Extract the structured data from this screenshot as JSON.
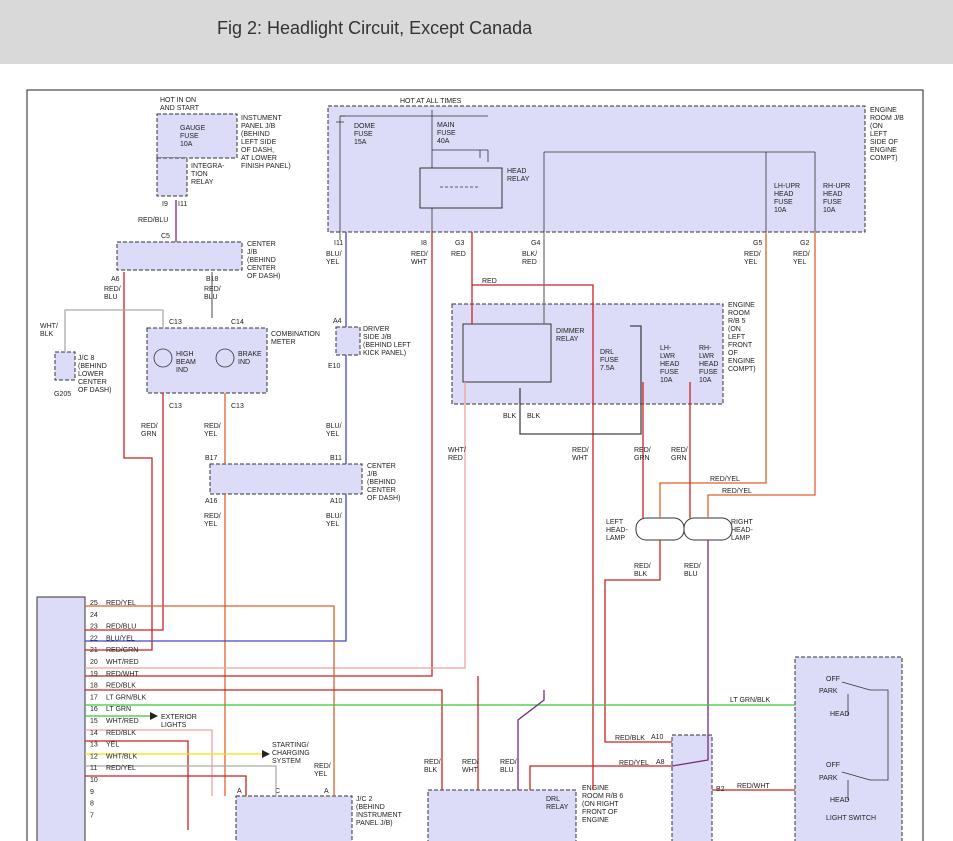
{
  "title": "Fig 2: Headlight Circuit, Except Canada",
  "labels": {
    "hot_in_on_start": "HOT IN ON\nAND START",
    "hot_at_all_times": "HOT AT ALL TIMES",
    "gauge_fuse": "GAUGE\nFUSE\n10A",
    "instrument_panel_jb": "INSTUMENT\nPANEL J/B\n(BEHIND\nLEFT SIDE\nOF DASH,\nAT LOWER\nFINISH PANEL)",
    "integration_relay": "INTEGRA-\nTION\nRELAY",
    "dome_fuse": "DOME\nFUSE\n15A",
    "main_fuse": "MAIN\nFUSE\n40A",
    "head_relay": "HEAD\nRELAY",
    "engine_room_jb": "ENGINE\nROOM J/B\n(ON\nLEFT\nSIDE OF\nENGINE\nCOMPT)",
    "lh_upr_fuse": "LH-UPR\nHEAD\nFUSE\n10A",
    "rh_upr_fuse": "RH-UPR\nHEAD\nFUSE\n10A",
    "center_jb_1": "CENTER\nJ/B\n(BEHIND\nCENTER\nOF DASH)",
    "combination_meter": "COMBINATION\nMETER",
    "high_beam_ind": "HIGH\nBEAM\nIND",
    "brake_ind": "BRAKE\nIND",
    "jc8": "J/C 8\n(BEHIND\nLOWER\nCENTER\nOF DASH)",
    "g205": "G205",
    "driver_side_jb": "DRIVER\nSIDE J/B\n(BEHIND LEFT\nKICK PANEL)",
    "engine_room_rb5": "ENGINE\nROOM\nR/B 5\n(ON\nLEFT\nFRONT\nOF\nENGINE\nCOMPT)",
    "dimmer_relay": "DIMMER\nRELAY",
    "drl_fuse": "DRL\nFUSE\n7.5A",
    "lh_lwr_fuse": "LH-\nLWR\nHEAD\nFUSE\n10A",
    "rh_lwr_fuse": "RH-\nLWR\nHEAD\nFUSE\n10A",
    "center_jb_2": "CENTER\nJ/B\n(BEHIND\nCENTER\nOF DASH)",
    "left_headlamp": "LEFT\nHEAD-\nLAMP",
    "right_headlamp": "RIGHT\nHEAD-\nLAMP",
    "exterior_lights": "EXTERIOR\nLIGHTS",
    "starting_charging": "STARTING/\nCHARGING\nSYSTEM",
    "jc2": "J/C 2\n(BEHIND\nINSTRUMENT\nPANEL J/B)",
    "engine_room_rb6": "ENGINE\nROOM R/B 6\n(ON RIGHT\nFRONT OF\nENGINE",
    "drl_relay": "DRL\nRELAY",
    "light_switch": "LIGHT SWITCH",
    "off": "OFF",
    "park": "PARK",
    "head": "HEAD"
  },
  "pins": [
    {
      "num": "25",
      "wire": "RED/YEL"
    },
    {
      "num": "24",
      "wire": ""
    },
    {
      "num": "23",
      "wire": "RED/BLU"
    },
    {
      "num": "22",
      "wire": "BLU/YEL"
    },
    {
      "num": "21",
      "wire": "RED/GRN"
    },
    {
      "num": "20",
      "wire": "WHT/RED"
    },
    {
      "num": "19",
      "wire": "RED/WHT"
    },
    {
      "num": "18",
      "wire": "RED/BLK"
    },
    {
      "num": "17",
      "wire": "LT GRN/BLK"
    },
    {
      "num": "16",
      "wire": "LT GRN"
    },
    {
      "num": "15",
      "wire": "WHT/RED"
    },
    {
      "num": "14",
      "wire": "RED/BLK"
    },
    {
      "num": "13",
      "wire": "YEL"
    },
    {
      "num": "12",
      "wire": "WHT/BLK"
    },
    {
      "num": "11",
      "wire": "RED/YEL"
    },
    {
      "num": "10",
      "wire": ""
    },
    {
      "num": "9",
      "wire": ""
    },
    {
      "num": "8",
      "wire": ""
    },
    {
      "num": "7",
      "wire": ""
    }
  ],
  "wire_labels": {
    "red_blu": "RED/BLU",
    "blu_yel": "BLU/\nYEL",
    "red_wht": "RED/\nWHT",
    "red": "RED",
    "blk_red": "BLK/\nRED",
    "red_yel": "RED/\nYEL",
    "red_blu2": "RED/\nBLU",
    "wht_blk": "WHT/\nBLK",
    "red_grn": "RED/\nGRN",
    "blk": "BLK",
    "wht_red": "WHT/\nRED",
    "red_blk": "RED/\nBLK",
    "red_yel_h": "RED/YEL",
    "lt_grn_blk": "LT GRN/BLK",
    "red_blk_h": "RED/BLK",
    "red_yel_h2": "RED/YEL",
    "red_wht_h": "RED/WHT"
  },
  "connectors": {
    "c5": "C5",
    "i9": "I9",
    "i11": "I11",
    "a6": "A6",
    "b18": "B18",
    "c13": "C13",
    "c14": "C14",
    "a": "A",
    "a4": "A4",
    "e10": "E10",
    "i11b": "I11",
    "i8": "I8",
    "g3": "G3",
    "g4": "G4",
    "g5": "G5",
    "g2": "G2",
    "b17": "B17",
    "b11": "B11",
    "a16": "A16",
    "a10": "A10",
    "a10b": "A10",
    "a8": "A8",
    "b2": "B2",
    "c": "C"
  }
}
